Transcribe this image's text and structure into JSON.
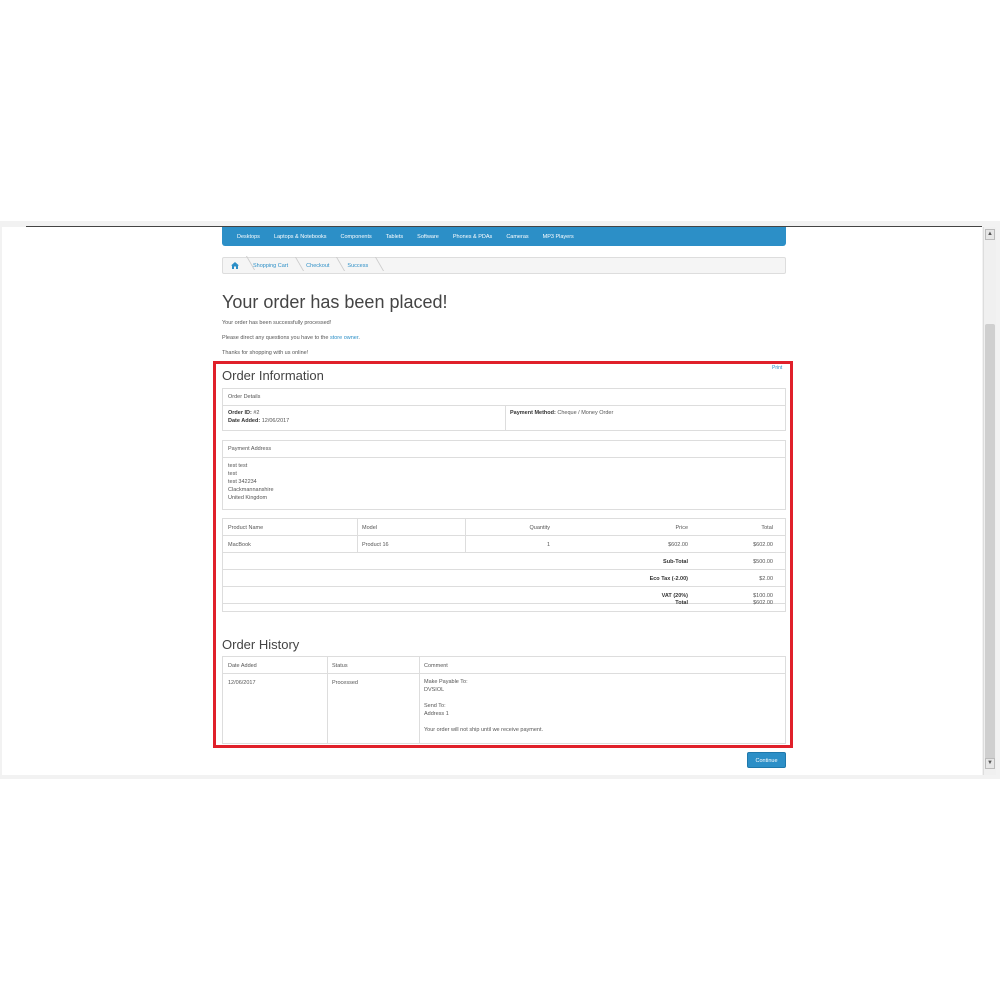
{
  "menu": {
    "items": [
      "Desktops",
      "Laptops & Notebooks",
      "Components",
      "Tablets",
      "Software",
      "Phones & PDAs",
      "Cameras",
      "MP3 Players"
    ]
  },
  "breadcrumb": {
    "items": [
      "Shopping Cart",
      "Checkout",
      "Success"
    ]
  },
  "page": {
    "title": "Your order has been placed!",
    "line1": "Your order has been successfully processed!",
    "line2_prefix": "Please direct any questions you have to the ",
    "line2_link": "store owner",
    "line2_suffix": ".",
    "line3": "Thanks for shopping with us online!"
  },
  "order_info": {
    "title": "Order Information",
    "print_label": "Print",
    "details_header": "Order Details",
    "order_id_label": "Order ID:",
    "order_id": "#2",
    "date_added_label": "Date Added:",
    "date_added": "12/06/2017",
    "payment_method_label": "Payment Method:",
    "payment_method": "Cheque / Money Order",
    "payment_address_header": "Payment Address",
    "address_lines": [
      "test test",
      "test",
      "test 342234",
      "Clackmannanshire",
      "United Kingdom"
    ]
  },
  "products": {
    "headers": {
      "name": "Product Name",
      "model": "Model",
      "quantity": "Quantity",
      "price": "Price",
      "total": "Total"
    },
    "rows": [
      {
        "name": "MacBook",
        "model": "Product 16",
        "quantity": "1",
        "price": "$602.00",
        "total": "$602.00"
      }
    ],
    "totals": [
      {
        "label": "Sub-Total",
        "value": "$500.00"
      },
      {
        "label": "Eco Tax (-2.00)",
        "value": "$2.00"
      },
      {
        "label": "VAT (20%)",
        "value": "$100.00"
      },
      {
        "label": "Total",
        "value": "$602.00"
      }
    ]
  },
  "history": {
    "title": "Order History",
    "headers": {
      "date": "Date Added",
      "status": "Status",
      "comment": "Comment"
    },
    "row": {
      "date": "12/06/2017",
      "status": "Processed",
      "comment_lines": [
        "Make Payable To:",
        "DVSIOL",
        "",
        "Send To:",
        "Address 1",
        "",
        "Your order will not ship until we receive payment."
      ]
    }
  },
  "actions": {
    "continue_label": "Continue"
  },
  "colors": {
    "accent": "#2c8fc7",
    "highlight_border": "#e0202a"
  }
}
